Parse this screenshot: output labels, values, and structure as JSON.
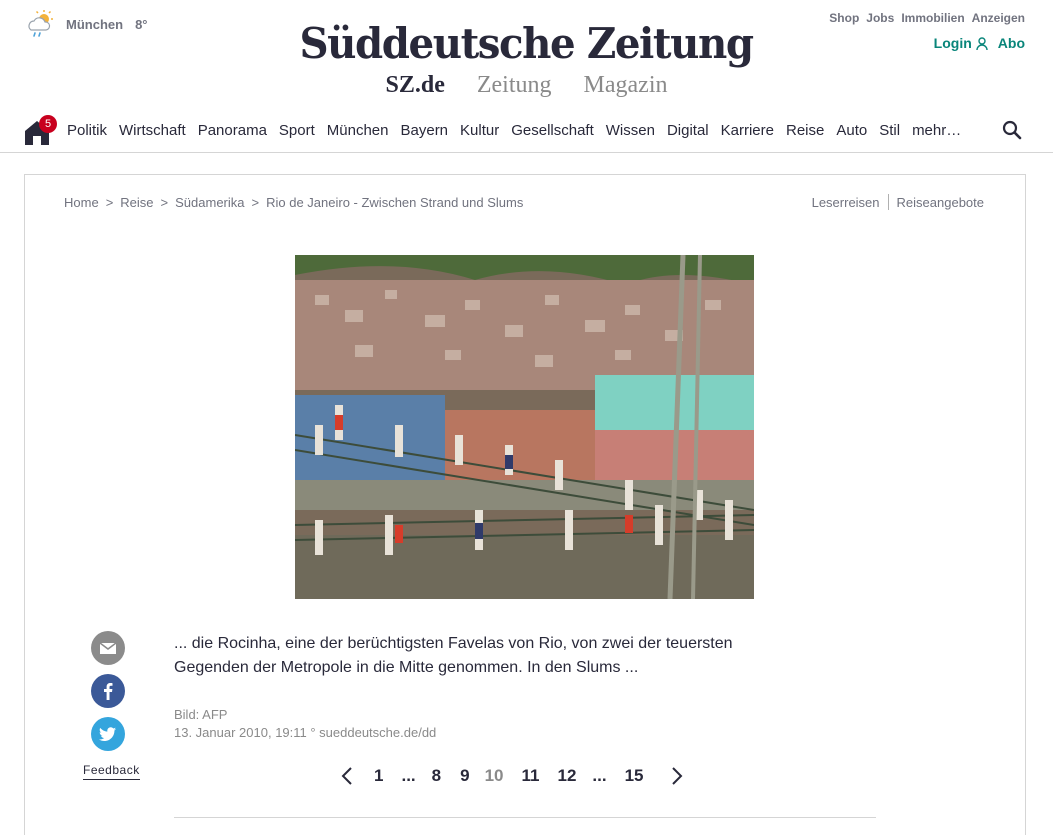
{
  "header": {
    "weather": {
      "icon": "sun-cloud-rain-icon",
      "city": "München",
      "temp": "8°"
    },
    "logo_text": "Süddeutsche Zeitung",
    "sublinks": [
      "SZ.de",
      "Zeitung",
      "Magazin"
    ],
    "toplinks": [
      "Shop",
      "Jobs",
      "Immobilien",
      "Anzeigen"
    ],
    "login": "Login",
    "abo": "Abo",
    "accent_color": "#09857a"
  },
  "nav": {
    "home_badge": "5",
    "items": [
      "Politik",
      "Wirtschaft",
      "Panorama",
      "Sport",
      "München",
      "Bayern",
      "Kultur",
      "Gesellschaft",
      "Wissen",
      "Digital",
      "Karriere",
      "Reise",
      "Auto",
      "Stil",
      "mehr…"
    ]
  },
  "breadcrumb": [
    "Home",
    ">",
    "Reise",
    ">",
    "Südamerika",
    ">",
    "Rio de Janeiro - Zwischen Strand und Slums"
  ],
  "rightlinks": [
    "Leserreisen",
    "Reiseangebote"
  ],
  "gallery": {
    "caption": "... die Rocinha, eine der berüchtigsten Favelas von Rio, von zwei der teuersten Gegenden der Metropole in die Mitte genommen. In den Slums ...",
    "credit": "Bild: AFP",
    "date_source": "13. Januar 2010, 19:11 ° sueddeutsche.de/dd"
  },
  "social": {
    "feedback": "Feedback"
  },
  "pagination": {
    "pages": [
      "1",
      "...",
      "8",
      "9",
      "10",
      "11",
      "12",
      "...",
      "15"
    ],
    "current": "10"
  }
}
